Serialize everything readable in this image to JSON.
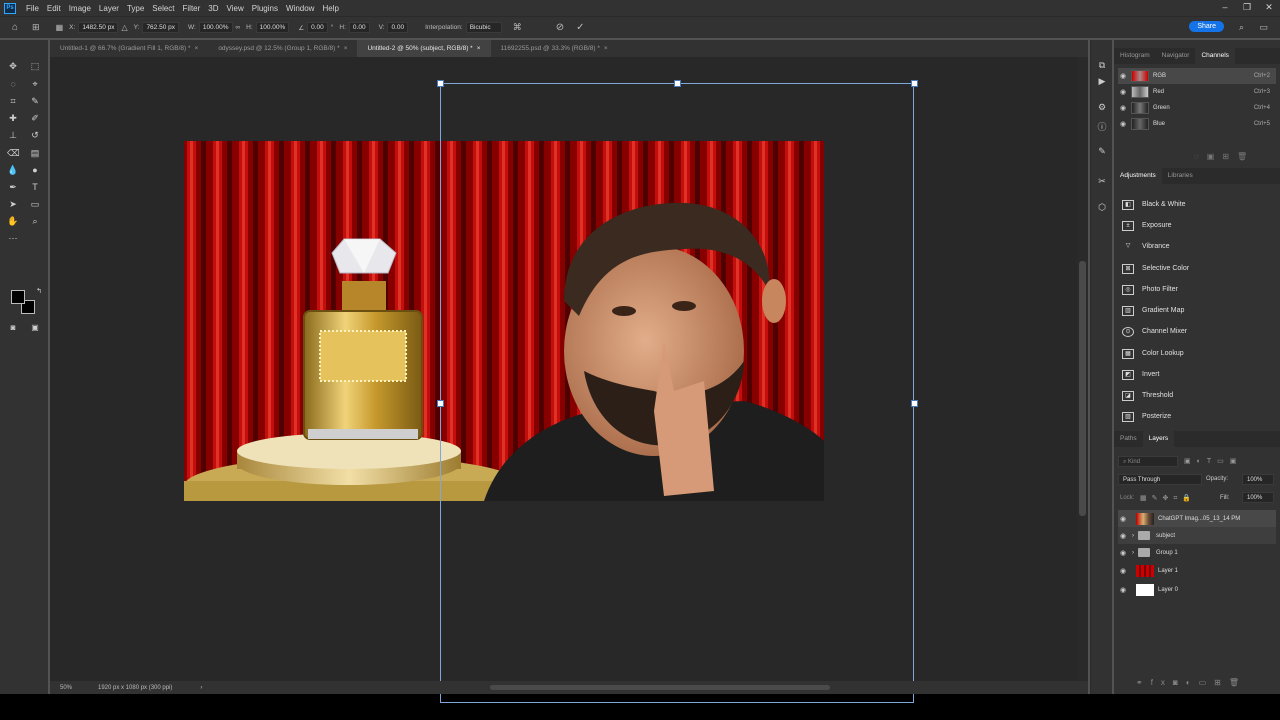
{
  "menubar": {
    "items": [
      "File",
      "Edit",
      "Image",
      "Layer",
      "Type",
      "Select",
      "Filter",
      "3D",
      "View",
      "Plugins",
      "Window",
      "Help"
    ],
    "logo": "Ps"
  },
  "options": {
    "x_label": "X:",
    "x_value": "1482.50 px",
    "y_label": "Y:",
    "y_value": "762.50 px",
    "w_label": "W:",
    "w_value": "100.00%",
    "h_label": "H:",
    "h_value": "100.00%",
    "angle_value": "0.00",
    "hskew_label": "H:",
    "hskew_value": "0.00",
    "vskew_label": "V:",
    "vskew_value": "0.00",
    "interp_label": "Interpolation:",
    "interp_value": "Bicubic",
    "share_label": "Share"
  },
  "tabs": [
    {
      "label": "Untitled-1 @ 66.7% (Gradient Fill 1, RGB/8) *",
      "active": false
    },
    {
      "label": "odyssey.psd @ 12.5% (Group 1, RGB/8) *",
      "active": false
    },
    {
      "label": "Untitled-2 @ 50% (subject, RGB/8) *",
      "active": true
    },
    {
      "label": "11692255.psd @ 33.3% (RGB/8) *",
      "active": false
    }
  ],
  "status": {
    "zoom": "50%",
    "doc_info": "1920 px x 1080 px (300 ppi)"
  },
  "channels_panel": {
    "tabs": [
      "Histogram",
      "Navigator",
      "Channels"
    ],
    "rows": [
      {
        "name": "RGB",
        "shortcut": "Ctrl+2"
      },
      {
        "name": "Red",
        "shortcut": "Ctrl+3"
      },
      {
        "name": "Green",
        "shortcut": "Ctrl+4"
      },
      {
        "name": "Blue",
        "shortcut": "Ctrl+5"
      }
    ]
  },
  "adjustments_panel": {
    "tabs": [
      "Adjustments",
      "Libraries"
    ],
    "items": [
      "Black & White",
      "Exposure",
      "Vibrance",
      "Selective Color",
      "Photo Filter",
      "Gradient Map",
      "Channel Mixer",
      "Color Lookup",
      "Invert",
      "Threshold",
      "Posterize"
    ]
  },
  "layers_panel": {
    "tabs": [
      "Paths",
      "Layers"
    ],
    "kind_placeholder": "Kind",
    "blend_mode": "Pass Through",
    "opacity_label": "Opacity:",
    "opacity_value": "100%",
    "lock_label": "Lock:",
    "fill_label": "Fill:",
    "fill_value": "100%",
    "layers": [
      {
        "name": "ChatGPT Imag...05_13_14 PM",
        "type": "image"
      },
      {
        "name": "subject",
        "type": "group"
      },
      {
        "name": "Group 1",
        "type": "group"
      },
      {
        "name": "Layer 1",
        "type": "red"
      },
      {
        "name": "Layer 0",
        "type": "white"
      }
    ]
  },
  "colors": {
    "accent": "#31a8ff",
    "share": "#1473e6",
    "curtain": "#c00000"
  }
}
